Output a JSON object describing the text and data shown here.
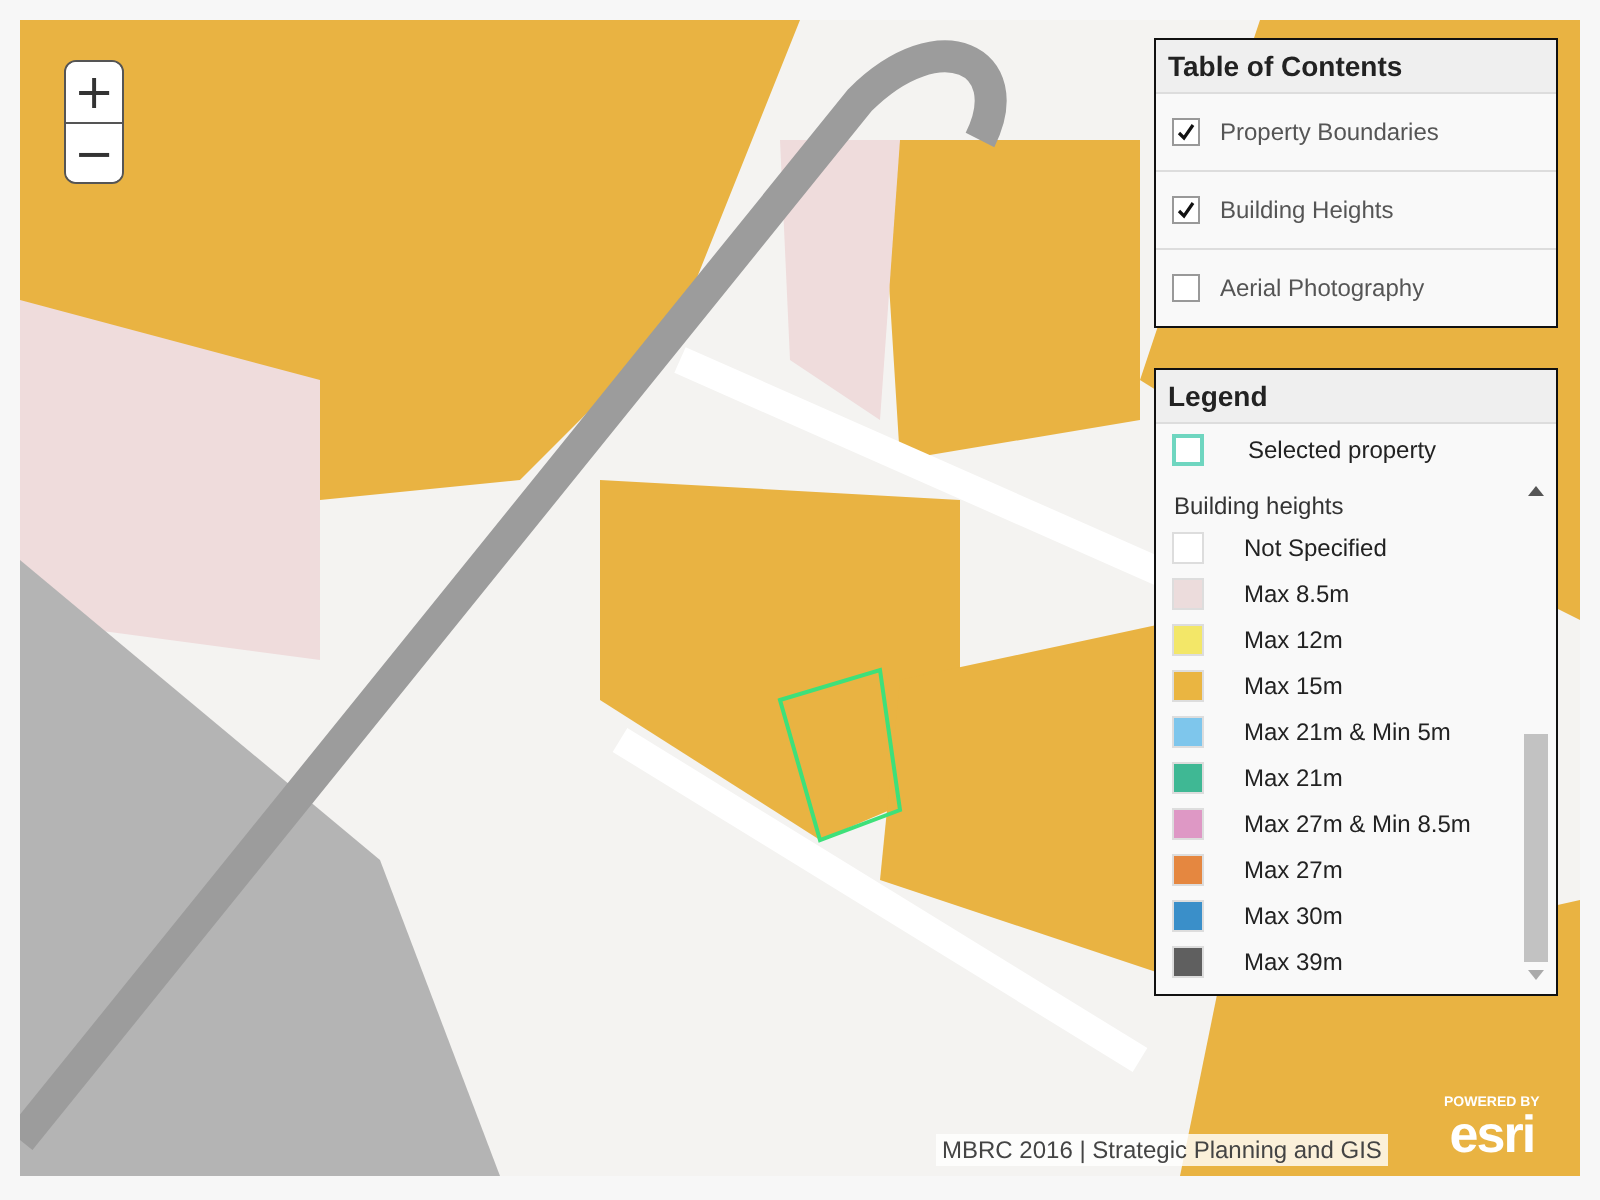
{
  "zoom": {
    "in": "+",
    "out": "−"
  },
  "toc": {
    "title": "Table of Contents",
    "layers": [
      {
        "label": "Property Boundaries",
        "checked": true
      },
      {
        "label": "Building Heights",
        "checked": true
      },
      {
        "label": "Aerial Photography",
        "checked": false
      }
    ]
  },
  "legend": {
    "title": "Legend",
    "selected": {
      "label": "Selected property",
      "color": "#6fd6c0"
    },
    "group": "Building heights",
    "items": [
      {
        "label": "Not Specified",
        "color": "#ffffff"
      },
      {
        "label": "Max 8.5m",
        "color": "#ecdcdc"
      },
      {
        "label": "Max 12m",
        "color": "#f3e768"
      },
      {
        "label": "Max 15m",
        "color": "#eab541"
      },
      {
        "label": "Max 21m & Min 5m",
        "color": "#7ec6ec"
      },
      {
        "label": "Max 21m",
        "color": "#3fb894"
      },
      {
        "label": "Max 27m & Min 8.5m",
        "color": "#de98c5"
      },
      {
        "label": "Max 27m",
        "color": "#e58740"
      },
      {
        "label": "Max 30m",
        "color": "#3a8fc9"
      },
      {
        "label": "Max 39m",
        "color": "#5f5f5f"
      }
    ]
  },
  "attribution": "MBRC 2016 | Strategic Planning and GIS",
  "logo": {
    "tagline": "POWERED BY",
    "name": "esri"
  }
}
